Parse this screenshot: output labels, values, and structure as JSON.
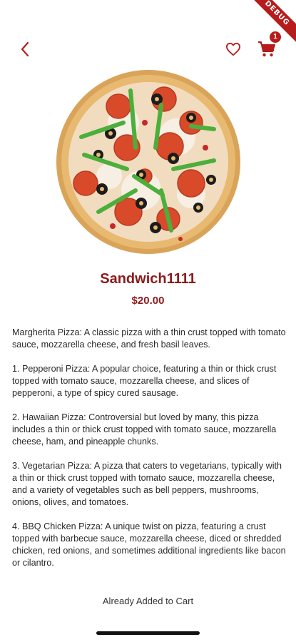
{
  "debug_banner": "DEBUG",
  "header": {
    "back_icon": "chevron-left-icon",
    "favorite_icon": "heart-outline-icon",
    "cart_icon": "shopping-cart-icon",
    "cart_count": "1",
    "accent_color": "#b71c1c"
  },
  "product": {
    "image_icon": "pizza-image",
    "title": "Sandwich1111",
    "price": "$20.00",
    "title_color": "#8e1b1b",
    "description": [
      "Margherita Pizza: A classic pizza with a thin crust topped with tomato sauce, mozzarella cheese, and fresh basil leaves.",
      "1. Pepperoni Pizza: A popular choice, featuring a thin or thick crust topped with tomato sauce, mozzarella cheese, and slices of pepperoni, a type of spicy cured sausage.",
      "2. Hawaiian Pizza: Controversial but loved by many, this pizza includes a thin or thick crust topped with tomato sauce, mozzarella cheese, ham, and pineapple chunks.",
      "3. Vegetarian Pizza: A pizza that caters to vegetarians, typically with a thin or thick crust topped with tomato sauce, mozzarella cheese, and a variety of vegetables such as bell peppers, mushrooms, onions, olives, and tomatoes.",
      "4. BBQ Chicken Pizza: A unique twist on pizza, featuring a crust topped with barbecue sauce, mozzarella cheese, diced or shredded chicken, red onions, and sometimes additional ingredients like bacon or cilantro."
    ]
  },
  "footer": {
    "cart_status": "Already Added to Cart"
  }
}
